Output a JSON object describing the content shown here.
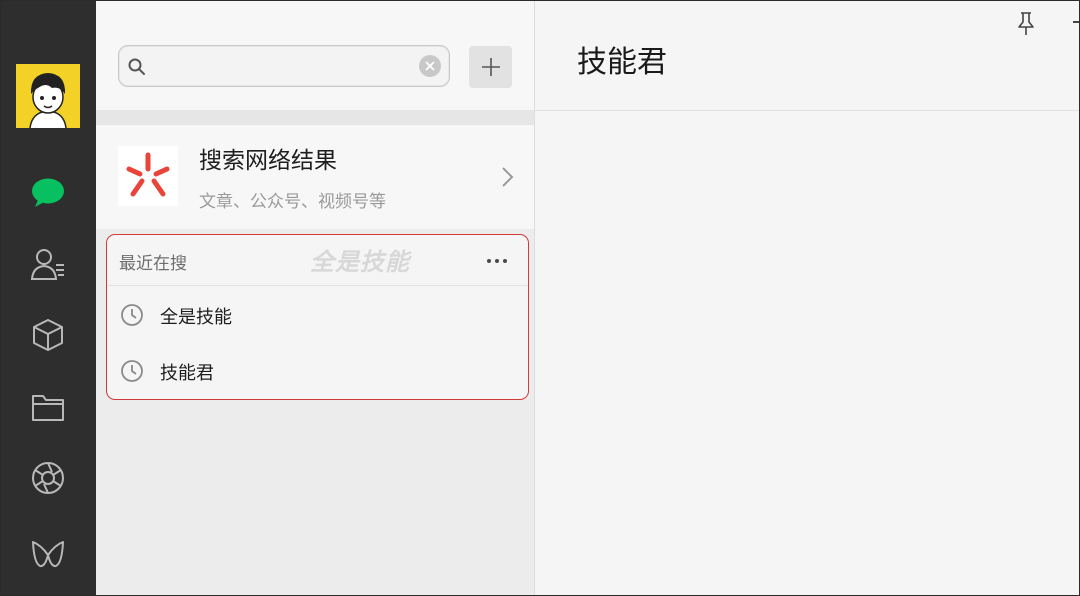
{
  "search": {
    "value": "",
    "placeholder": ""
  },
  "web_search": {
    "title": "搜索网络结果",
    "subtitle": "文章、公众号、视频号等"
  },
  "recent": {
    "header": "最近在搜",
    "watermark": "全是技能",
    "items": [
      {
        "label": "全是技能"
      },
      {
        "label": "技能君"
      }
    ]
  },
  "chat": {
    "title": "技能君"
  },
  "nav": {
    "items": [
      "chat-icon",
      "contacts-icon",
      "favorites-icon",
      "folder-icon",
      "moments-icon",
      "channels-icon"
    ],
    "active_color": "#07c160"
  },
  "colors": {
    "highlight_border": "#d33a3a",
    "logo_red": "#e8443a",
    "avatar_bg": "#f3d127"
  }
}
